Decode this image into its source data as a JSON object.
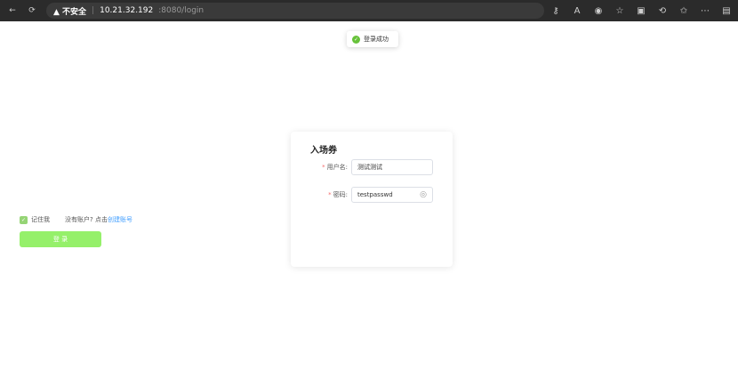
{
  "browser": {
    "back_icon": "back-arrow-icon",
    "reload_icon": "reload-icon",
    "security_label": "▲ 不安全",
    "address_host": "10.21.32.192",
    "address_path": ":8080/login"
  },
  "toast": {
    "text": "登录成功",
    "status": "success"
  },
  "login": {
    "title": "入场券",
    "username_label": "用户名:",
    "username_value": "测试测试",
    "password_label": "密码:",
    "password_value": "testpasswd",
    "remember_label": "记住我",
    "signup_prefix": "没有账户? 点击",
    "signup_link": "创建账号",
    "submit_label": "登 录"
  },
  "colors": {
    "accent_green": "#95f06a",
    "checkbox_green": "#95d475",
    "success_green": "#67c23a",
    "required_red": "#f56c6c",
    "link_blue": "#409eff"
  }
}
